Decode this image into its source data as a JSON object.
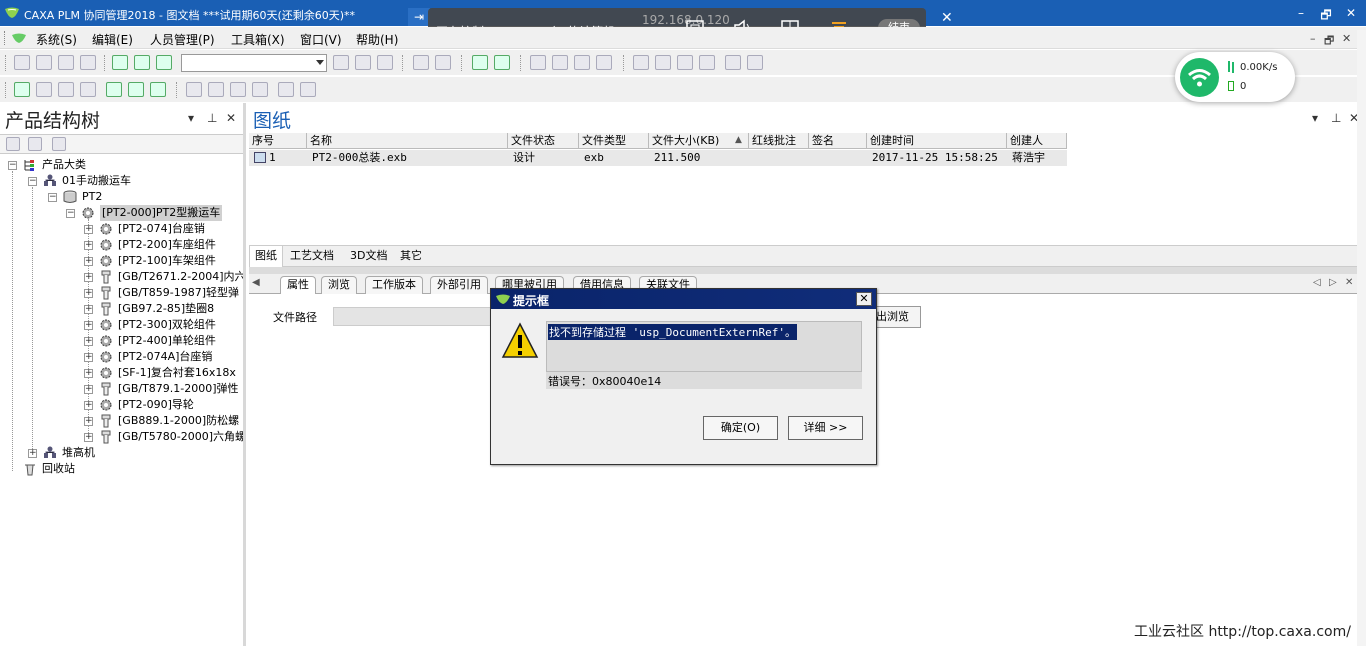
{
  "titlebar": {
    "title": "CAXA PLM 协同管理2018 - 图文档    ***试用期60天(还剩余60天)**",
    "min_label": "–",
    "restore_label": "🗗",
    "close_label": "✕"
  },
  "remote": {
    "bg_text": "192.168.0.120",
    "label": "正在控制 、X HAO=宇ʒ的计算机",
    "end_label": "结束",
    "close_label": "✕",
    "pin_label": "⇥"
  },
  "menubar": {
    "items": [
      "系统(S)",
      "编辑(E)",
      "人员管理(P)",
      "工具箱(X)",
      "窗口(V)",
      "帮助(H)"
    ],
    "mdi_min": "–",
    "mdi_restore": "🗗",
    "mdi_close": "✕"
  },
  "network": {
    "speed": "0.00K/s",
    "count": "0"
  },
  "left_panel": {
    "title": "产品结构树",
    "tree": [
      {
        "label": "产品大类",
        "expander": "−"
      },
      {
        "label": "01手动搬运车",
        "expander": "−"
      },
      {
        "label": "PT2",
        "expander": "−"
      },
      {
        "label": "[PT2-000]PT2型搬运车",
        "expander": "−"
      },
      {
        "label": "[PT2-074]台座销",
        "expander": "+"
      },
      {
        "label": "[PT2-200]车座组件",
        "expander": "+"
      },
      {
        "label": "[PT2-100]车架组件",
        "expander": "+"
      },
      {
        "label": "[GB/T2671.2-2004]内六",
        "expander": "+"
      },
      {
        "label": "[GB/T859-1987]轻型弹",
        "expander": "+"
      },
      {
        "label": "[GB97.2-85]垫圈8",
        "expander": "+"
      },
      {
        "label": "[PT2-300]双轮组件",
        "expander": "+"
      },
      {
        "label": "[PT2-400]单轮组件",
        "expander": "+"
      },
      {
        "label": "[PT2-074A]台座销",
        "expander": "+"
      },
      {
        "label": "[SF-1]复合衬套16x18x",
        "expander": "+"
      },
      {
        "label": "[GB/T879.1-2000]弹性",
        "expander": "+"
      },
      {
        "label": "[PT2-090]导轮",
        "expander": "+"
      },
      {
        "label": "[GB889.1-2000]防松螺",
        "expander": "+"
      },
      {
        "label": "[GB/T5780-2000]六角螺",
        "expander": "+"
      },
      {
        "label": "堆高机",
        "expander": "+"
      },
      {
        "label": "回收站",
        "expander": ""
      }
    ]
  },
  "right_panel": {
    "title": "图纸",
    "columns": [
      "序号",
      "名称",
      "文件状态",
      "文件类型",
      "文件大小(KB)",
      "红线批注",
      "签名",
      "创建时间",
      "创建人"
    ],
    "rows": [
      [
        "1",
        "PT2-000总装.exb",
        "设计",
        "exb",
        "211.500",
        "",
        "",
        "2017-11-25 15:58:25",
        "蒋浩宇"
      ]
    ],
    "doc_tabs": [
      "图纸",
      "工艺文档",
      "3D文档",
      "其它"
    ],
    "prop_tabs": [
      "属性",
      "浏览",
      "工作版本",
      "外部引用",
      "哪里被引用",
      "借用信息",
      "关联文件"
    ],
    "path_label": "文件路径",
    "browse_label": "出浏览"
  },
  "dialog": {
    "title": "提示框",
    "message": "找不到存储过程 'usp_DocumentExternRef'。",
    "error": "错误号：0x80040e14",
    "ok_label": "确定(O)",
    "detail_label": "详细 >>",
    "close_label": "✕"
  },
  "footer": {
    "text": "工业云社区 http://top.caxa.com/"
  }
}
